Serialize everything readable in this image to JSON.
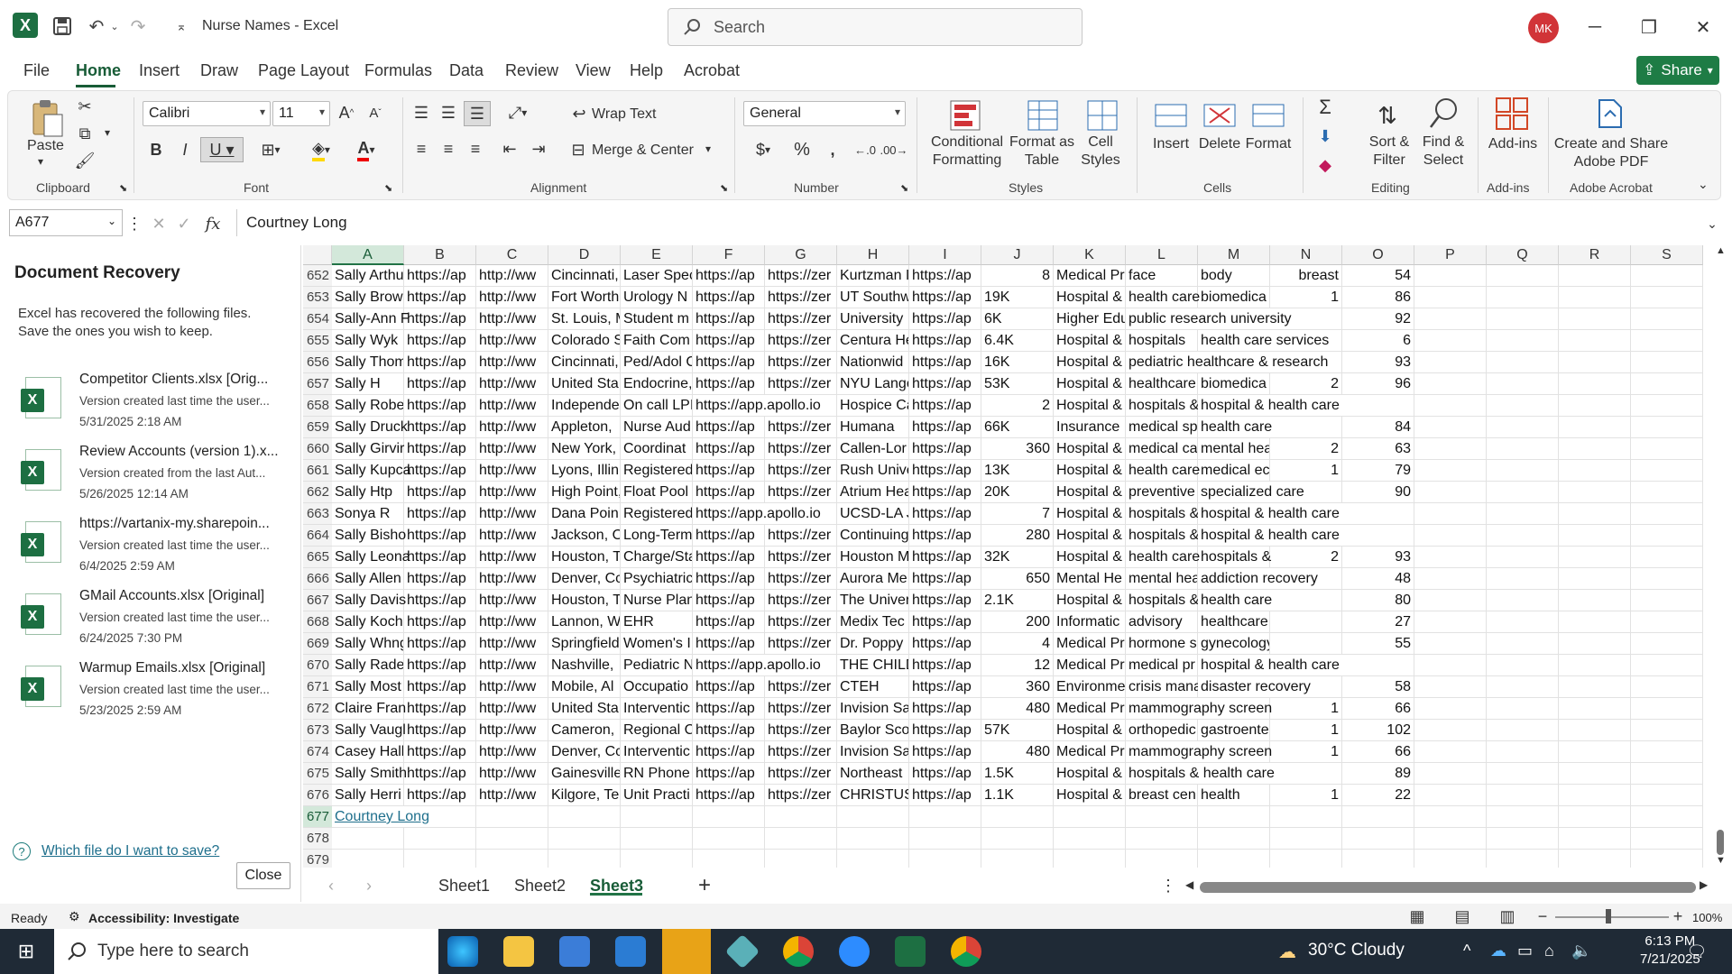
{
  "window": {
    "title": "Nurse Names  -  Excel",
    "search_placeholder": "Search",
    "avatar_initials": "MK"
  },
  "menu": {
    "items": [
      "File",
      "Home",
      "Insert",
      "Draw",
      "Page Layout",
      "Formulas",
      "Data",
      "Review",
      "View",
      "Help",
      "Acrobat"
    ],
    "share": "Share"
  },
  "ribbon": {
    "clipboard": {
      "paste": "Paste",
      "label": "Clipboard"
    },
    "font": {
      "name": "Calibri",
      "size": "11",
      "label": "Font"
    },
    "alignment": {
      "wrap": "Wrap Text",
      "merge": "Merge & Center",
      "label": "Alignment"
    },
    "number": {
      "format": "General",
      "label": "Number"
    },
    "styles": {
      "conditional": "Conditional\nFormatting",
      "format_table": "Format as\nTable",
      "cell_styles": "Cell\nStyles",
      "label": "Styles"
    },
    "cells": {
      "insert": "Insert",
      "delete": "Delete",
      "format": "Format",
      "label": "Cells"
    },
    "editing": {
      "sort": "Sort &\nFilter",
      "find": "Find &\nSelect",
      "label": "Editing"
    },
    "addins": {
      "addins": "Add-ins",
      "label": "Add-ins"
    },
    "acrobat": {
      "create": "Create and Share\nAdobe PDF",
      "label": "Adobe Acrobat"
    }
  },
  "formula_bar": {
    "name_box": "A677",
    "fx": "fx",
    "value": "Courtney Long"
  },
  "recovery": {
    "title": "Document Recovery",
    "description": "Excel has recovered the following files.  Save the ones you wish to keep.",
    "files": [
      {
        "name": "Competitor Clients.xlsx  [Orig...",
        "line1": "Version created last time the user...",
        "line2": "5/31/2025 2:18 AM"
      },
      {
        "name": "Review Accounts (version 1).x...",
        "line1": "Version created from the last Aut...",
        "line2": "5/26/2025 12:14 AM"
      },
      {
        "name": "https://vartanix-my.sharepoin...",
        "line1": "Version created last time the user...",
        "line2": "6/4/2025 2:59 AM"
      },
      {
        "name": "GMail Accounts.xlsx  [Original]",
        "line1": "Version created last time the user...",
        "line2": "6/24/2025 7:30 PM"
      },
      {
        "name": "Warmup Emails.xlsx  [Original]",
        "line1": "Version created last time the user...",
        "line2": "5/23/2025 2:59 AM"
      }
    ],
    "help_link": "Which file do I want to save?",
    "close": "Close"
  },
  "grid": {
    "columns": [
      "A",
      "B",
      "C",
      "D",
      "E",
      "F",
      "G",
      "H",
      "I",
      "J",
      "K",
      "L",
      "M",
      "N",
      "O",
      "P",
      "Q",
      "R",
      "S"
    ],
    "selected_column": "A",
    "selected_row": "677",
    "rows": [
      {
        "n": "652",
        "c": [
          "Sally Arthu",
          "https://ap",
          "http://ww",
          "Cincinnati,",
          "Laser Spec",
          "https://ap",
          "https://zer",
          "Kurtzman I",
          "https://ap",
          "8",
          "Medical Pr",
          "face",
          "body",
          "breast",
          "54"
        ]
      },
      {
        "n": "653",
        "c": [
          "Sally Brow",
          "https://ap",
          "http://ww",
          "Fort Worth",
          "Urology N",
          "https://ap",
          "https://zer",
          "UT Southw",
          "https://ap",
          "19K",
          "Hospital &",
          "health care",
          "biomedica",
          "1",
          "86"
        ]
      },
      {
        "n": "654",
        "c": [
          "Sally-Ann F",
          "https://ap",
          "http://ww",
          "St. Louis, M",
          "Student m",
          "https://ap",
          "https://zer",
          "University",
          "https://ap",
          "6K",
          "Higher Edu",
          "public research university",
          "",
          "",
          "92"
        ]
      },
      {
        "n": "655",
        "c": [
          "Sally Wyk",
          "https://ap",
          "http://ww",
          "Colorado S",
          "Faith Com",
          "https://ap",
          "https://zer",
          "Centura He",
          "https://ap",
          "6.4K",
          "Hospital &",
          "hospitals",
          "health care services",
          "",
          "6"
        ]
      },
      {
        "n": "656",
        "c": [
          "Sally Thom",
          "https://ap",
          "http://ww",
          "Cincinnati,",
          "Ped/Adol C",
          "https://ap",
          "https://zer",
          "Nationwid",
          "https://ap",
          "16K",
          "Hospital &",
          "pediatric healthcare & research",
          "",
          "",
          "93"
        ]
      },
      {
        "n": "657",
        "c": [
          "Sally H",
          "https://ap",
          "http://ww",
          "United Sta",
          "Endocrine,",
          "https://ap",
          "https://zer",
          "NYU Lango",
          "https://ap",
          "53K",
          "Hospital &",
          "healthcare",
          "biomedica",
          "2",
          "96"
        ]
      },
      {
        "n": "658",
        "c": [
          "Sally Robe",
          "https://ap",
          "http://ww",
          "Independe",
          "On call LPI",
          "https://app.apollo.io",
          "",
          "Hospice Ca",
          "https://ap",
          "2",
          "Hospital &",
          "hospitals &",
          "hospital & health care",
          "",
          ""
        ]
      },
      {
        "n": "659",
        "c": [
          "Sally Druck",
          "https://ap",
          "http://ww",
          "Appleton,",
          "Nurse Aud",
          "https://ap",
          "https://zer",
          "Humana",
          "https://ap",
          "66K",
          "Insurance",
          "medical sp",
          "health care",
          "",
          "84"
        ]
      },
      {
        "n": "660",
        "c": [
          "Sally Girvir",
          "https://ap",
          "http://ww",
          "New York,",
          "Coordinat",
          "https://ap",
          "https://zer",
          "Callen-Lor",
          "https://ap",
          "360",
          "Hospital &",
          "medical ca",
          "mental hea",
          "2",
          "63"
        ]
      },
      {
        "n": "661",
        "c": [
          "Sally Kupca",
          "https://ap",
          "http://ww",
          "Lyons, Illin",
          "Registered",
          "https://ap",
          "https://zer",
          "Rush Unive",
          "https://ap",
          "13K",
          "Hospital &",
          "health care",
          "medical ec",
          "1",
          "79"
        ]
      },
      {
        "n": "662",
        "c": [
          "Sally Htp",
          "https://ap",
          "http://ww",
          "High Point,",
          "Float Pool",
          "https://ap",
          "https://zer",
          "Atrium Hea",
          "https://ap",
          "20K",
          "Hospital &",
          "preventive",
          "specialized care",
          "",
          "90"
        ]
      },
      {
        "n": "663",
        "c": [
          "Sonya R",
          "https://ap",
          "http://ww",
          "Dana Poin",
          "Registered",
          "https://app.apollo.io",
          "",
          "UCSD-LA J",
          "https://ap",
          "7",
          "Hospital &",
          "hospitals &",
          "hospital & health care",
          "",
          ""
        ]
      },
      {
        "n": "664",
        "c": [
          "Sally Bisho",
          "https://ap",
          "http://ww",
          "Jackson, O",
          "Long-Term",
          "https://ap",
          "https://zer",
          "Continuing",
          "https://ap",
          "280",
          "Hospital &",
          "hospitals &",
          "hospital & health care",
          "",
          ""
        ]
      },
      {
        "n": "665",
        "c": [
          "Sally Leona",
          "https://ap",
          "http://ww",
          "Houston, T",
          "Charge/Sta",
          "https://ap",
          "https://zer",
          "Houston M",
          "https://ap",
          "32K",
          "Hospital &",
          "health care",
          "hospitals &",
          "2",
          "93"
        ]
      },
      {
        "n": "666",
        "c": [
          "Sally Allen",
          "https://ap",
          "http://ww",
          "Denver, Cc",
          "Psychiatric",
          "https://ap",
          "https://zer",
          "Aurora Me",
          "https://ap",
          "650",
          "Mental He",
          "mental hea",
          "addiction recovery",
          "",
          "48"
        ]
      },
      {
        "n": "667",
        "c": [
          "Sally Davis",
          "https://ap",
          "http://ww",
          "Houston, T",
          "Nurse Plan",
          "https://ap",
          "https://zer",
          "The Univer",
          "https://ap",
          "2.1K",
          "Hospital &",
          "hospitals &",
          "health care",
          "",
          "80"
        ]
      },
      {
        "n": "668",
        "c": [
          "Sally Koch",
          "https://ap",
          "http://ww",
          "Lannon, W",
          "EHR",
          "https://ap",
          "https://zer",
          "Medix Tec",
          "https://ap",
          "200",
          "Informatic",
          "advisory",
          "healthcare",
          "",
          "27"
        ]
      },
      {
        "n": "669",
        "c": [
          "Sally Whng",
          "https://ap",
          "http://ww",
          "Springfield",
          "Women's I",
          "https://ap",
          "https://zer",
          "Dr. Poppy",
          "https://ap",
          "4",
          "Medical Pr",
          "hormone s",
          "gynecology",
          "",
          "55"
        ]
      },
      {
        "n": "670",
        "c": [
          "Sally Rade",
          "https://ap",
          "http://ww",
          "Nashville,",
          "Pediatric N",
          "https://app.apollo.io",
          "",
          "THE CHILD",
          "https://ap",
          "12",
          "Medical Pr",
          "medical pr",
          "hospital & health care",
          "",
          ""
        ]
      },
      {
        "n": "671",
        "c": [
          "Sally Most",
          "https://ap",
          "http://ww",
          "Mobile, Al",
          "Occupatio",
          "https://ap",
          "https://zer",
          "CTEH",
          "https://ap",
          "360",
          "Environme",
          "crisis mana",
          "disaster recovery",
          "",
          "58"
        ]
      },
      {
        "n": "672",
        "c": [
          "Claire Fran",
          "https://ap",
          "http://ww",
          "United Sta",
          "Interventic",
          "https://ap",
          "https://zer",
          "Invision Sa",
          "https://ap",
          "480",
          "Medical Pr",
          "mammography screen",
          "",
          "1",
          "66"
        ]
      },
      {
        "n": "673",
        "c": [
          "Sally Vaugl",
          "https://ap",
          "http://ww",
          "Cameron,",
          "Regional C",
          "https://ap",
          "https://zer",
          "Baylor Sco",
          "https://ap",
          "57K",
          "Hospital &",
          "orthopedic",
          "gastroente",
          "1",
          "102"
        ]
      },
      {
        "n": "674",
        "c": [
          "Casey Hall",
          "https://ap",
          "http://ww",
          "Denver, Cc",
          "Interventic",
          "https://ap",
          "https://zer",
          "Invision Sa",
          "https://ap",
          "480",
          "Medical Pr",
          "mammography screen",
          "",
          "1",
          "66"
        ]
      },
      {
        "n": "675",
        "c": [
          "Sally Smith",
          "https://ap",
          "http://ww",
          "Gainesville",
          "RN Phone",
          "https://ap",
          "https://zer",
          "Northeast",
          "https://ap",
          "1.5K",
          "Hospital &",
          "hospitals & health care",
          "",
          "",
          "89"
        ]
      },
      {
        "n": "676",
        "c": [
          "Sally Herri",
          "https://ap",
          "http://ww",
          "Kilgore, Te",
          "Unit Practi",
          "https://ap",
          "https://zer",
          "CHRISTUS",
          "https://ap",
          "1.1K",
          "Hospital &",
          "breast cen",
          "health",
          "1",
          "22"
        ]
      },
      {
        "n": "677",
        "c": [
          "Courtney Long"
        ]
      },
      {
        "n": "678",
        "c": []
      },
      {
        "n": "679",
        "c": []
      }
    ]
  },
  "sheets": {
    "tabs": [
      "Sheet1",
      "Sheet2",
      "Sheet3"
    ],
    "active": "Sheet3"
  },
  "status": {
    "ready": "Ready",
    "accessibility": "Accessibility: Investigate",
    "zoom": "100%"
  },
  "taskbar": {
    "search": "Type here to search",
    "weather": "30°C  Cloudy",
    "time": "6:13 PM",
    "date": "7/21/2025"
  },
  "colors": {
    "excel_green": "#217346",
    "accent_dark": "#185c37",
    "avatar": "#d13438"
  }
}
